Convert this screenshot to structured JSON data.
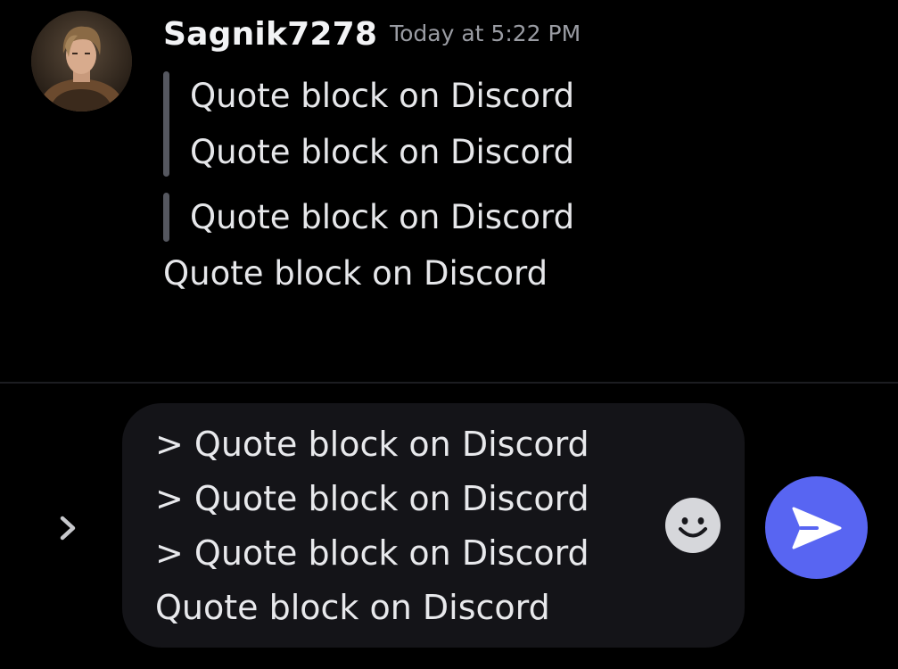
{
  "message": {
    "author": "Sagnik7278",
    "timestamp": "Today at 5:22 PM",
    "avatar_icon": "user-avatar-icon",
    "quote_group_1": [
      "Quote block on Discord",
      "Quote block on Discord"
    ],
    "quote_group_2": [
      "Quote block on Discord"
    ],
    "plain_text": "Quote block on Discord"
  },
  "composer": {
    "lines": [
      "> Quote block on Discord",
      "> Quote block on Discord",
      "> Quote block on Discord",
      "Quote block on Discord"
    ],
    "expand_icon": "chevron-right-icon",
    "emoji_icon": "smiley-face-icon",
    "send_icon": "send-arrow-icon"
  },
  "colors": {
    "background": "#000000",
    "quote_bar": "#55575f",
    "composer_bg": "#141418",
    "send_button": "#5865f2",
    "timestamp": "#9a9ca3"
  }
}
